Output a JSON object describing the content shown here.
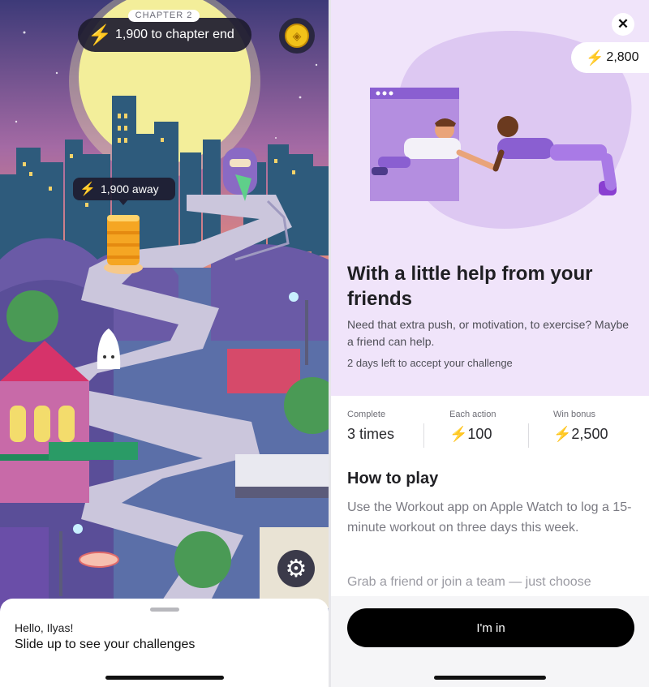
{
  "map": {
    "chapter_label": "CHAPTER 2",
    "chapter_progress": "1,900 to chapter end",
    "away_label": "1,900 away",
    "bolt_icon": "⚡"
  },
  "sheet": {
    "greeting": "Hello, Ilyas!",
    "message": "Slide up to see your challenges"
  },
  "challenge": {
    "points": "2,800",
    "title": "With a little help from your friends",
    "description": "Need that extra push, or motivation, to exercise? Maybe a friend can help.",
    "deadline": "2 days left to accept your challenge",
    "stats": [
      {
        "label": "Complete",
        "value": "3 times"
      },
      {
        "label": "Each action",
        "value": "100"
      },
      {
        "label": "Win bonus",
        "value": "2,500"
      }
    ],
    "how_to_title": "How to play",
    "how_to_text": "Use the Workout app on Apple Watch to log a 15-minute workout on three days this week.",
    "how_to_text2": "Grab a friend or join a team — just choose",
    "cta": "I'm in"
  },
  "colors": {
    "accent_bolt": "#e8248f",
    "hero_bg": "#f0e4fa",
    "button_bg": "#000000"
  }
}
